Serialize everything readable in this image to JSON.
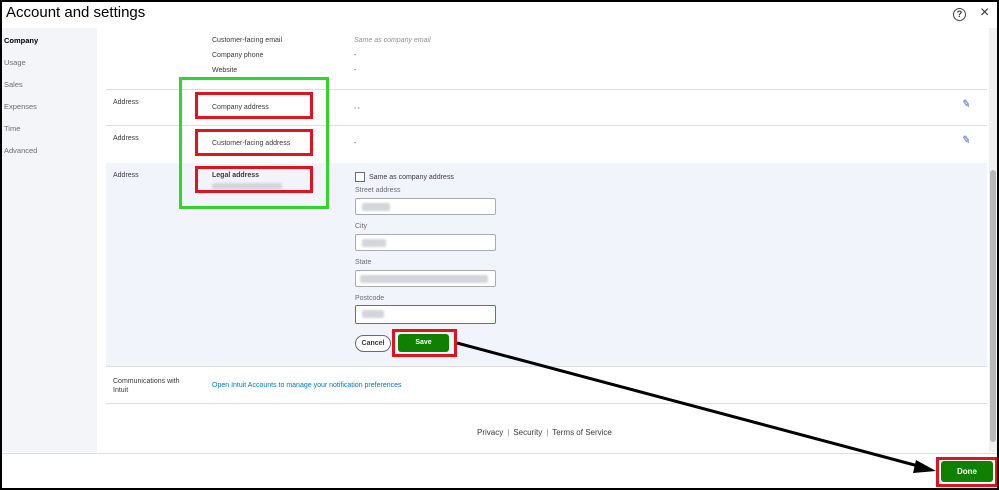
{
  "window": {
    "title": "Account and settings",
    "help_icon": "?",
    "close_icon": "×"
  },
  "sidebar": {
    "items": [
      {
        "label": "Company",
        "active": true
      },
      {
        "label": "Usage"
      },
      {
        "label": "Sales"
      },
      {
        "label": "Expenses"
      },
      {
        "label": "Time"
      },
      {
        "label": "Advanced"
      }
    ]
  },
  "contact": {
    "email_label": "Customer-facing email",
    "email_value": "Same as company email",
    "phone_label": "Company phone",
    "phone_value": "-",
    "website_label": "Website",
    "website_value": "-"
  },
  "company_address": {
    "section": "Address",
    "label": "Company address",
    "value": ", ,"
  },
  "customer_address": {
    "section": "Address",
    "label": "Customer-facing address",
    "value": "-"
  },
  "legal_address": {
    "section": "Address",
    "label": "Legal address",
    "same_as_label": "Same as company address",
    "street_label": "Street address",
    "city_label": "City",
    "state_label": "State",
    "postcode_label": "Postcode",
    "cancel_label": "Cancel",
    "save_label": "Save"
  },
  "communications": {
    "label": "Communications with Intuit",
    "link": "Open Intuit Accounts to manage your notification preferences"
  },
  "footer": {
    "privacy": "Privacy",
    "security": "Security",
    "terms": "Terms of Service",
    "separator": "|"
  },
  "done_label": "Done",
  "colors": {
    "primary_green": "#108000",
    "annotation_red": "#e0141e",
    "annotation_green": "#32d62a",
    "link_blue": "#0077c5"
  }
}
